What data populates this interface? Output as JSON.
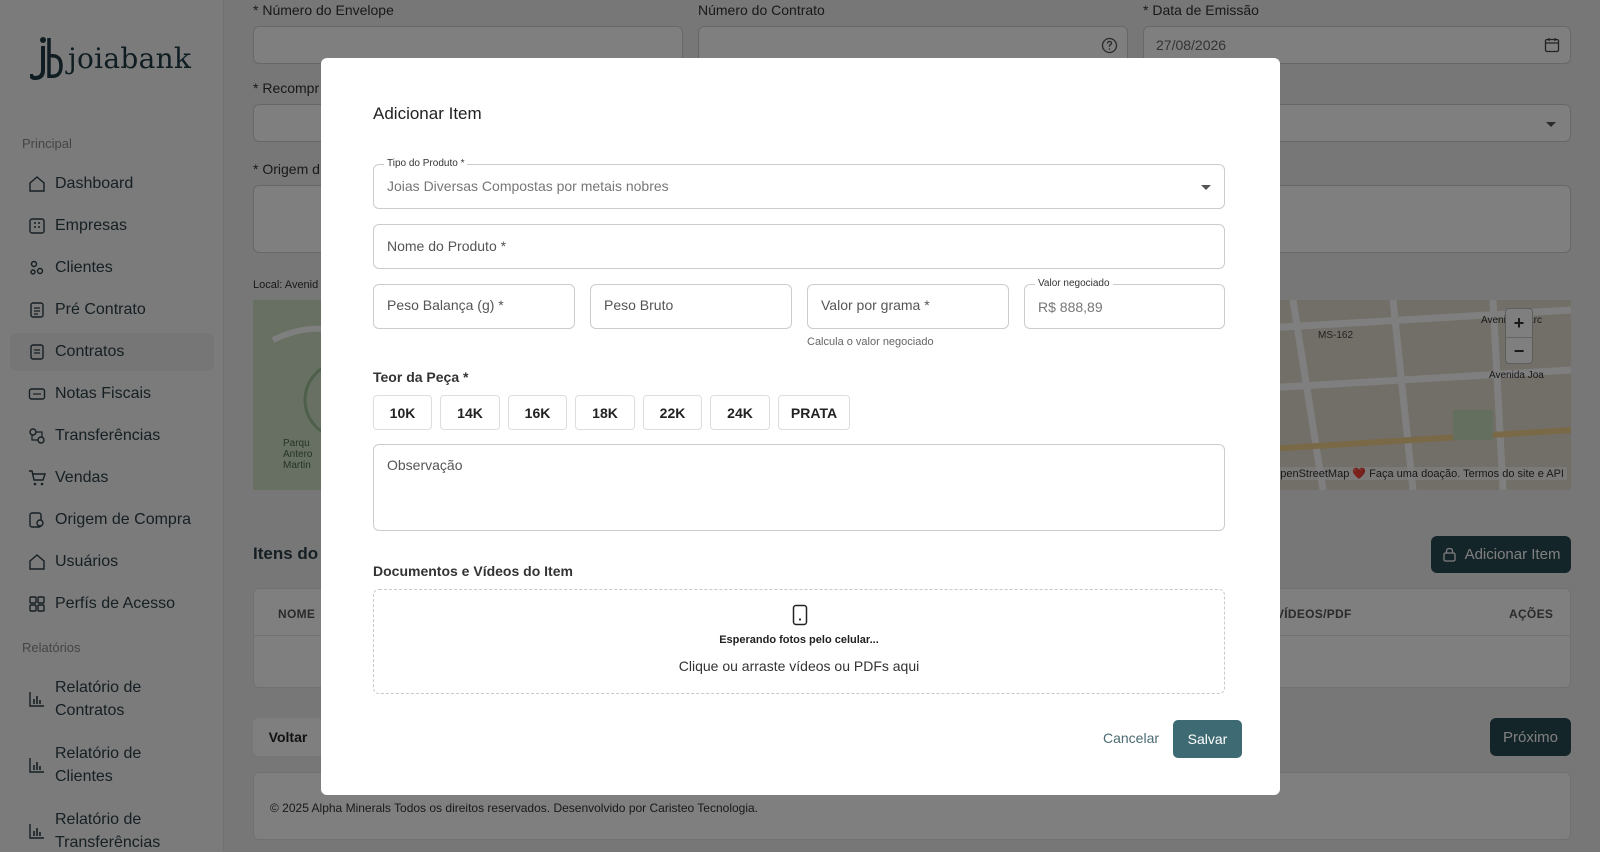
{
  "brand": {
    "name": "joiabank"
  },
  "sidebar": {
    "section_principal": "Principal",
    "section_relatorios": "Relatórios",
    "items": [
      {
        "label": "Dashboard"
      },
      {
        "label": "Empresas"
      },
      {
        "label": "Clientes"
      },
      {
        "label": "Pré Contrato"
      },
      {
        "label": "Contratos"
      },
      {
        "label": "Notas Fiscais"
      },
      {
        "label": "Transferências"
      },
      {
        "label": "Vendas"
      },
      {
        "label": "Origem de Compra"
      },
      {
        "label": "Usuários"
      },
      {
        "label": "Perfís de Acesso"
      }
    ],
    "reports": [
      {
        "label1": "Relatório de",
        "label2": "Contratos"
      },
      {
        "label1": "Relatório de",
        "label2": "Clientes"
      },
      {
        "label1": "Relatório de",
        "label2": "Transferências"
      }
    ]
  },
  "form": {
    "envelope_label": "* Número do Envelope",
    "contrato_label": "Número do Contrato",
    "emissao_label": "* Data de Emissão",
    "emissao_value": "27/08/2026",
    "recompra_label": "* Recompr",
    "origem_label": "* Origem d",
    "local_label": "Local: Avenid"
  },
  "map": {
    "road_label": "MS-162",
    "street1": "Avenida Marc",
    "street2": "Avenida Joa",
    "attribution": "penStreetMap ❤️ Faça uma doação. Termos do site e API",
    "park_label": "Parqu Antero Martin",
    "zoom_in": "+",
    "zoom_out": "−"
  },
  "items_section": {
    "title": "Itens do C",
    "add_button": "Adicionar Item",
    "col_nome": "NOME",
    "col_docs": "S/VÍDEOS/PDF",
    "col_acoes": "AÇÕES"
  },
  "nav_buttons": {
    "back": "Voltar",
    "next": "Próximo"
  },
  "footer": {
    "text": "© 2025 Alpha Minerals Todos os direitos reservados. Desenvolvido por Caristeo Tecnologia."
  },
  "modal": {
    "title": "Adicionar Item",
    "tipo_label": "Tipo do Produto *",
    "tipo_value": "Joias Diversas Compostas por metais nobres",
    "nome_placeholder": "Nome do Produto *",
    "peso_balanca_placeholder": "Peso Balança (g) *",
    "peso_bruto_placeholder": "Peso Bruto",
    "valor_grama_placeholder": "Valor por grama *",
    "valor_grama_helper": "Calcula o valor negociado",
    "valor_negociado_label": "Valor negociado",
    "valor_negociado_value": "R$ 888,89",
    "teor_label": "Teor da Peça *",
    "teor_options": [
      "10K",
      "14K",
      "16K",
      "18K",
      "22K",
      "24K",
      "PRATA"
    ],
    "observacao_placeholder": "Observação",
    "docs_title": "Documentos e Vídeos do Item",
    "waiting_text": "Esperando fotos pelo celular...",
    "drop_text": "Clique ou arraste vídeos ou PDFs aqui",
    "cancel": "Cancelar",
    "save": "Salvar"
  },
  "colors": {
    "primary": "#294a52",
    "save": "#3e6a73",
    "overlay": "rgba(0,0,0,0.5)"
  }
}
